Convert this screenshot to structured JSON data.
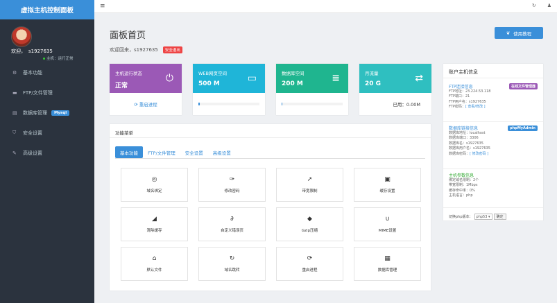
{
  "sidebar": {
    "brand": "虚拟主机控制面板",
    "welcome_label": "欢迎，",
    "username": "s1927635",
    "host_status": "主机：运行正常",
    "items": [
      {
        "label": "基本功能",
        "icon": "gear-icon",
        "glyph": "⚙"
      },
      {
        "label": "FTP/文件管理",
        "icon": "folder-icon",
        "glyph": "▬"
      },
      {
        "label": "数据库管理",
        "icon": "database-icon",
        "glyph": "▤",
        "badge": "Mysql"
      },
      {
        "label": "安全设置",
        "icon": "shield-icon",
        "glyph": "⛉"
      },
      {
        "label": "高级设置",
        "icon": "edit-icon",
        "glyph": "✎"
      }
    ]
  },
  "topbar": {
    "menu_icon": "menu-icon",
    "refresh_icon": "refresh-icon",
    "user_icon": "user-icon"
  },
  "header": {
    "title": "面板首页",
    "welcome": "欢迎回来，s1927635",
    "logout": "安全退出",
    "tutorial": "使用教程"
  },
  "cards": [
    {
      "label": "主机运行状态",
      "value": "正常",
      "color": "#9b59b6",
      "icon": "power-icon",
      "glyph": "⏻",
      "foot": "重启进程"
    },
    {
      "label": "WEB网页空间",
      "value": "500 M",
      "color": "#1fb5d8",
      "icon": "hdd-icon",
      "glyph": "▭",
      "progress": 0.02
    },
    {
      "label": "数据库空间",
      "value": "200 M",
      "color": "#1fb58f",
      "icon": "database-icon",
      "glyph": "≣",
      "progress": 0.01
    },
    {
      "label": "月流量",
      "value": "20 G",
      "color": "#2fbfc0",
      "icon": "transfer-icon",
      "glyph": "⇄",
      "used": "已用：0.00M"
    }
  ],
  "functions": {
    "title": "功能菜单",
    "tabs": [
      "基本功能",
      "FTP/文件管理",
      "安全设置",
      "高级设置"
    ],
    "items": [
      {
        "label": "域名绑定",
        "icon": "globe-icon",
        "glyph": "◎"
      },
      {
        "label": "修改密码",
        "icon": "wrench-icon",
        "glyph": "🔧"
      },
      {
        "label": "带宽限制",
        "icon": "rocket-icon",
        "glyph": "➚"
      },
      {
        "label": "缓存设置",
        "icon": "save-icon",
        "glyph": "▣"
      },
      {
        "label": "清除缓存",
        "icon": "eraser-icon",
        "glyph": "◢"
      },
      {
        "label": "自定义错误页",
        "icon": "paperclip-icon",
        "glyph": "∂"
      },
      {
        "label": "Gzip压缩",
        "icon": "dropbox-icon",
        "glyph": "◆"
      },
      {
        "label": "MIME设置",
        "icon": "magnet-icon",
        "glyph": "∪"
      },
      {
        "label": "默认文件",
        "icon": "home-icon",
        "glyph": "⌂"
      },
      {
        "label": "域名跳转",
        "icon": "redo-icon",
        "glyph": "↻"
      },
      {
        "label": "重启进程",
        "icon": "refresh-icon",
        "glyph": "⟳"
      },
      {
        "label": "数据库管理",
        "icon": "table-icon",
        "glyph": "▦"
      }
    ]
  },
  "account": {
    "title": "账户主机信息",
    "ftp": {
      "title": "FTP连接信息",
      "badge": "在线文件管理器",
      "lines": [
        "FTP地址：23.224.53.118",
        "FTP端口：21",
        "FTP用户名：s1927635"
      ],
      "pass_label": "FTP密码：",
      "pass_link": "[ 查看/修改 ]"
    },
    "db": {
      "title": "数据库链接信息",
      "badge": "phpMyAdmin",
      "lines": [
        "数据库地址：localhost",
        "数据库端口：3306",
        "数据库名：s1927635",
        "数据库用户名：s1927635"
      ],
      "pass_label": "数据库密码：",
      "pass_link": "[ 修改密码 ]"
    },
    "host": {
      "title": "主机参数信息",
      "lines": [
        "绑定域名限制：2个",
        "带宽限制：1Mbps",
        "缓存命中率：0%",
        "主机语言：php"
      ]
    },
    "php_label": "切换php版本：",
    "php_value": "php53",
    "php_ok": "确定"
  }
}
